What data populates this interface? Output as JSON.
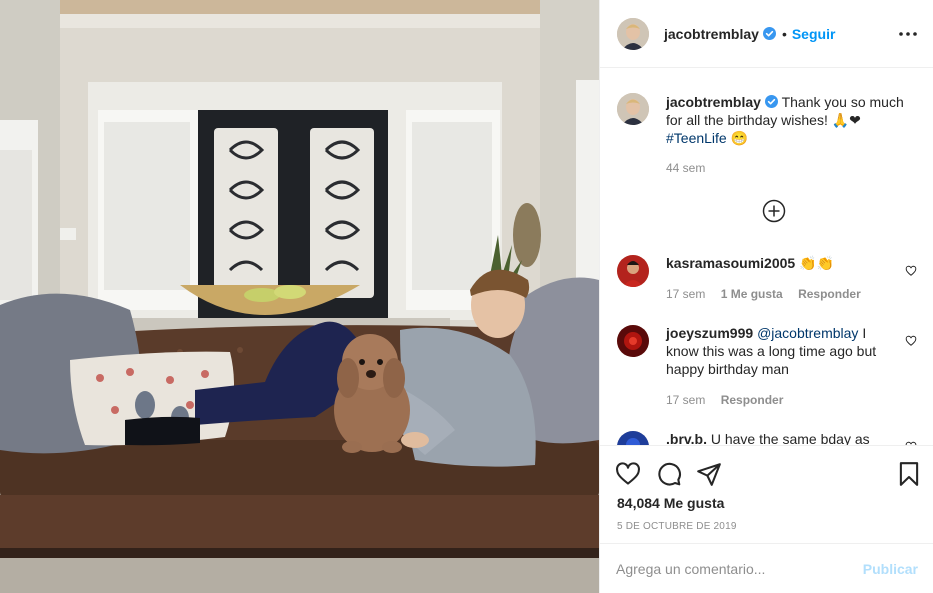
{
  "post": {
    "author": "jacobtremblay",
    "verified": true,
    "follow_separator": "•",
    "follow_label": "Seguir",
    "more_icon": "more-horizontal-icon",
    "caption": {
      "author": "jacobtremblay",
      "text": "Thank you so much for all the birthday wishes! 🙏❤",
      "hashtag": "#TeenLife",
      "emoji": "😁",
      "time": "44 sem"
    },
    "load_more_icon": "plus-circle-icon"
  },
  "comments": [
    {
      "username": "kasramasoumi2005",
      "text": "👏👏",
      "time": "17 sem",
      "likes": "1 Me gusta",
      "reply": "Responder"
    },
    {
      "username": "joeyszum999",
      "mention": "@jacobtremblay",
      "text": "I know this was a long time ago but happy birthday man",
      "time": "17 sem",
      "reply": "Responder"
    },
    {
      "username": ".brv.b.",
      "text": "U have the same bday as"
    }
  ],
  "actions": {
    "like_icon": "heart-icon",
    "comment_icon": "comment-icon",
    "share_icon": "paper-plane-icon",
    "save_icon": "bookmark-icon"
  },
  "likes_label": "84,084 Me gusta",
  "date": "5 DE OCTUBRE DE 2019",
  "add_comment": {
    "placeholder": "Agrega un comentario...",
    "publish_label": "Publicar"
  },
  "colors": {
    "link_blue": "#0095f6",
    "publish_disabled": "#b2dffc",
    "hashtag": "#00376b",
    "secondary_text": "#8e8e8e"
  }
}
